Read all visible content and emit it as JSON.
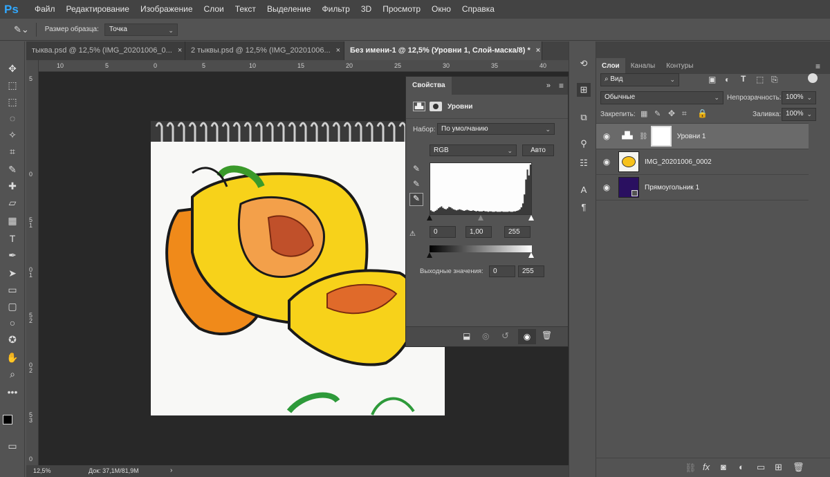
{
  "app": {
    "logo": "Ps"
  },
  "menu": [
    "Файл",
    "Редактирование",
    "Изображение",
    "Слои",
    "Текст",
    "Выделение",
    "Фильтр",
    "3D",
    "Просмотр",
    "Окно",
    "Справка"
  ],
  "options": {
    "sample_size_label": "Размер образца:",
    "sample_size_value": "Точка"
  },
  "tabs": [
    {
      "label": "тыква.psd @ 12,5% (IMG_20201006_0...",
      "close": "×"
    },
    {
      "label": "2 тыквы.psd @ 12,5% (IMG_20201006...",
      "close": "×"
    },
    {
      "label": "Без имени-1 @ 12,5% (Уровни 1, Слой-маска/8) *",
      "close": "×"
    }
  ],
  "ruler_h": [
    "10",
    "5",
    "0",
    "5",
    "10",
    "15",
    "20",
    "25",
    "30",
    "35",
    "40"
  ],
  "ruler_v": [
    "5",
    "0",
    "5",
    "1",
    "0",
    "1",
    "5",
    "2",
    "0",
    "2",
    "5",
    "3",
    "0",
    "3"
  ],
  "properties": {
    "tab_label": "Свойства",
    "title": "Уровни",
    "preset_label": "Набор:",
    "preset_value": "По умолчанию",
    "channel_value": "RGB",
    "auto_button": "Авто",
    "input_black": "0",
    "input_mid": "1,00",
    "input_white": "255",
    "output_label": "Выходные значения:",
    "output_black": "0",
    "output_white": "255",
    "histogram": [
      8,
      6,
      5,
      7,
      9,
      12,
      14,
      16,
      13,
      11,
      10,
      12,
      15,
      14,
      12,
      10,
      9,
      8,
      9,
      10,
      9,
      8,
      7,
      8,
      9,
      8,
      7,
      7,
      8,
      7,
      6,
      7,
      6,
      6,
      6,
      7,
      6,
      6,
      5,
      6,
      6,
      5,
      5,
      6,
      5,
      5,
      5,
      6,
      5,
      5,
      5,
      5,
      6,
      5,
      5,
      6,
      6,
      7,
      8,
      10,
      14,
      22,
      40,
      70,
      90,
      78,
      100
    ]
  },
  "layers_panel": {
    "tabs": [
      "Слои",
      "Каналы",
      "Контуры"
    ],
    "filter_label": "Вид",
    "blend_mode": "Обычные",
    "opacity_label": "Непрозрачность:",
    "opacity_value": "100%",
    "lock_label": "Закрепить:",
    "fill_label": "Заливка:",
    "fill_value": "100%",
    "layers": [
      {
        "name": "Уровни 1",
        "selected": true
      },
      {
        "name": "IMG_20201006_0002",
        "selected": false
      },
      {
        "name": "Прямоугольник 1",
        "selected": false
      }
    ]
  },
  "status": {
    "zoom": "12,5%",
    "doc": "Док: 37,1M/81,9M"
  },
  "colors": {
    "accent": "#31a8ff",
    "rect_layer": "#2a1060",
    "panel_bg": "#535353"
  }
}
